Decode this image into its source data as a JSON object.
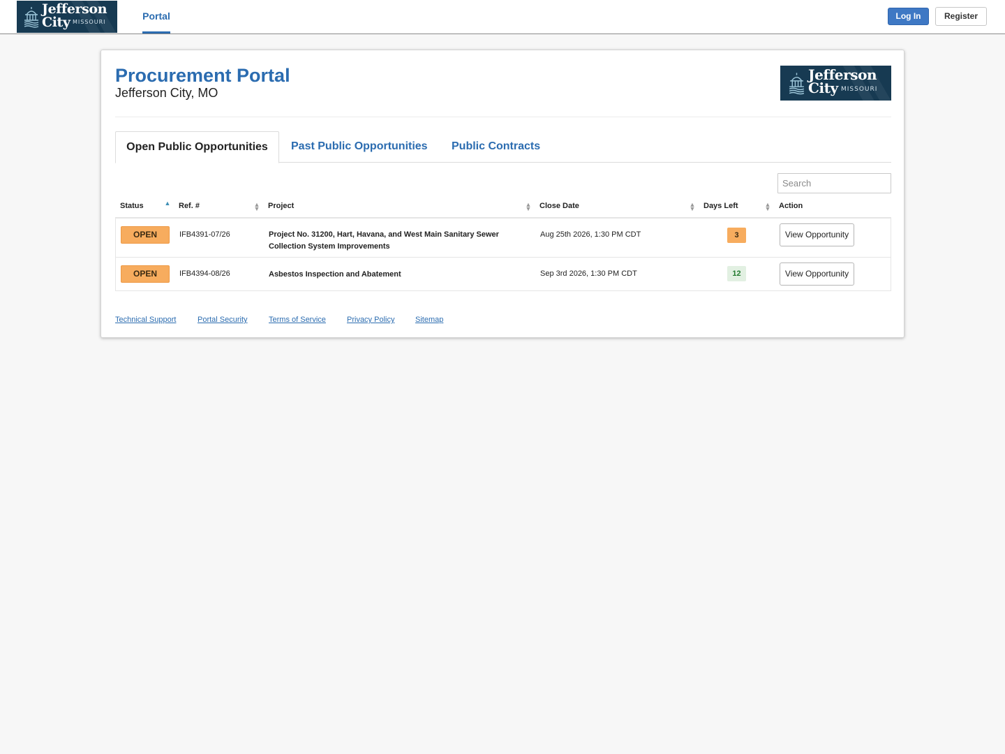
{
  "topbar": {
    "logo": {
      "line1": "Jefferson",
      "line2": "City",
      "state": "MISSOURI"
    },
    "nav": {
      "portal": "Portal"
    },
    "login_label": "Log In",
    "register_label": "Register"
  },
  "header": {
    "title": "Procurement Portal",
    "subtitle": "Jefferson City, MO",
    "logo": {
      "line1": "Jefferson",
      "line2": "City",
      "state": "MISSOURI"
    }
  },
  "tabs": [
    {
      "label": "Open Public Opportunities",
      "active": true
    },
    {
      "label": "Past Public Opportunities",
      "active": false
    },
    {
      "label": "Public Contracts",
      "active": false
    }
  ],
  "search": {
    "placeholder": "Search",
    "value": ""
  },
  "table": {
    "columns": [
      "Status",
      "Ref. #",
      "Project",
      "Close Date",
      "Days Left",
      "Action"
    ],
    "rows": [
      {
        "status": "OPEN",
        "ref": "IFB4391-07/26",
        "project": "Project No. 31200, Hart, Havana, and West Main Sanitary Sewer Collection System Improvements",
        "close_date": "Aug 25th 2026, 1:30 PM CDT",
        "days_left": "3",
        "action": "View Opportunity"
      },
      {
        "status": "OPEN",
        "ref": "IFB4394-08/26",
        "project": "Asbestos Inspection and Abatement",
        "close_date": "Sep 3rd 2026, 1:30 PM CDT",
        "days_left": "12",
        "action": "View Opportunity"
      }
    ]
  },
  "footer": {
    "links": [
      "Technical Support",
      "Portal Security",
      "Terms of Service",
      "Privacy Policy",
      "Sitemap"
    ]
  },
  "colors": {
    "brand_blue": "#2b6cb0",
    "logo_navy": "#173a52",
    "status_open": "#f7ac5e",
    "days_ok": "#e2f0e2",
    "login_button": "#3e78c4"
  },
  "icons": [
    "capitol-dome-icon",
    "sort-asc-icon",
    "sort-both-icon"
  ]
}
